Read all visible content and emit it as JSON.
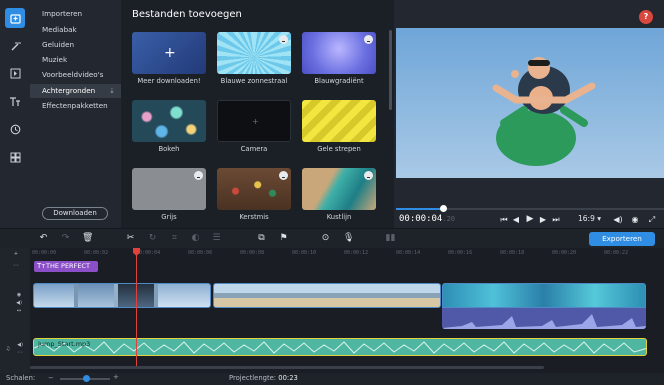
{
  "sidebar": {
    "categories": [
      {
        "label": "Importeren"
      },
      {
        "label": "Mediabak"
      },
      {
        "label": "Geluiden"
      },
      {
        "label": "Muziek"
      },
      {
        "label": "Voorbeeldvideo's"
      },
      {
        "label": "Achtergronden",
        "active": true
      },
      {
        "label": "Effectenpakketten"
      }
    ],
    "download_button": "Downloaden"
  },
  "gallery": {
    "title": "Bestanden toevoegen",
    "tiles": [
      {
        "label": "Meer downloaden!",
        "icon": "plus-icon"
      },
      {
        "label": "Blauwe zonnestraal",
        "icon": "download-icon"
      },
      {
        "label": "Blauwgradiënt",
        "icon": "download-icon"
      },
      {
        "label": "Bokeh"
      },
      {
        "label": "Camera"
      },
      {
        "label": "Gele strepen"
      },
      {
        "label": "Grijs",
        "icon": "download-icon"
      },
      {
        "label": "Kerstmis",
        "icon": "download-icon"
      },
      {
        "label": "Kustlijn",
        "icon": "download-icon"
      }
    ]
  },
  "player": {
    "help_label": "?",
    "timecode": "00:00:04",
    "timecode_suffix": ".20",
    "aspect_ratio": "16:9 ▾",
    "progress": 0.17
  },
  "toolbar": {
    "export_label": "Exporteren"
  },
  "timeline": {
    "ruler_ticks": [
      "00:00:00",
      "00:00:02",
      "00:00:04",
      "00:00:06",
      "00:00:08",
      "00:00:10",
      "00:00:12",
      "00:00:14",
      "00:00:16",
      "00:00:18",
      "00:00:20",
      "00:00:22"
    ],
    "title_clip": "THE PERFECT",
    "music_clip": "Jump_Start.mp3"
  },
  "status": {
    "scale_label": "Schalen:",
    "project_length_label": "Projectlengte:",
    "project_length_value": "00:23"
  },
  "colors": {
    "accent": "#2f8de4",
    "playhead": "#e0413b",
    "title_clip": "#8b4fc8",
    "music_clip": "#4fb7a1",
    "selection": "#e2d33b"
  }
}
